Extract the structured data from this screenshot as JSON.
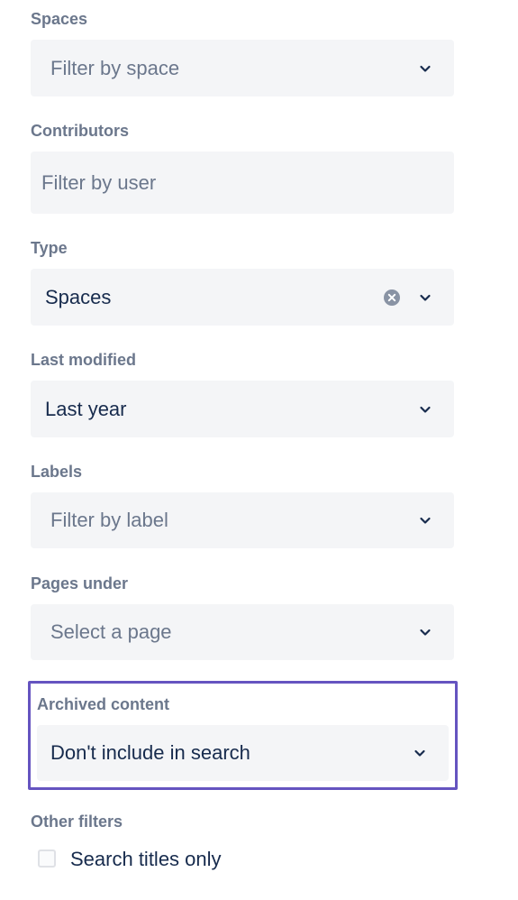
{
  "filters": {
    "spaces": {
      "label": "Spaces",
      "placeholder": "Filter by space"
    },
    "contributors": {
      "label": "Contributors",
      "placeholder": "Filter by user"
    },
    "type": {
      "label": "Type",
      "value": "Spaces"
    },
    "last_modified": {
      "label": "Last modified",
      "value": "Last year"
    },
    "labels": {
      "label": "Labels",
      "placeholder": "Filter by label"
    },
    "pages_under": {
      "label": "Pages under",
      "placeholder": "Select a page"
    },
    "archived": {
      "label": "Archived content",
      "value": "Don't include in search"
    },
    "other": {
      "label": "Other filters",
      "search_titles_only": "Search titles only"
    }
  },
  "icons": {
    "chevron": "chevron-down-icon",
    "clear": "clear-icon"
  },
  "colors": {
    "field_bg": "#f4f5f7",
    "label_text": "#6b778c",
    "value_text": "#172b4d",
    "highlight_border": "#6554c0"
  }
}
